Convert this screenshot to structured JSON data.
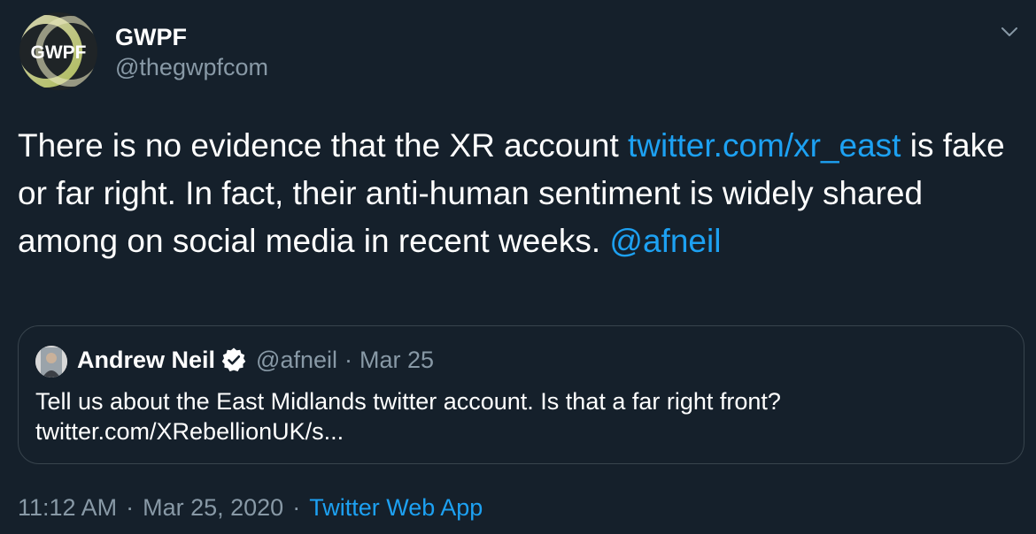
{
  "author": {
    "display_name": "GWPF",
    "handle": "@thegwpfcom",
    "avatar_text": "GWPF"
  },
  "tweet": {
    "text_part1": "There is no evidence that the XR account ",
    "link1": "twitter.com/xr_east",
    "text_part2": " is fake or far right. In fact, their anti-human sentiment is widely shared among on social media in recent weeks. ",
    "mention": "@afneil"
  },
  "quoted_tweet": {
    "display_name": "Andrew Neil",
    "verified": true,
    "handle": "@afneil",
    "separator": "·",
    "date": "Mar 25",
    "text_line1": "Tell us about the East Midlands twitter account. Is that a far right front?",
    "text_line2": "twitter.com/XRebellionUK/s..."
  },
  "meta": {
    "time": "11:12 AM",
    "separator": "·",
    "date": "Mar 25, 2020",
    "separator2": "·",
    "source": "Twitter Web App"
  },
  "colors": {
    "background": "#15202b",
    "link": "#1da1f2",
    "secondary_text": "#8899a6",
    "border": "#38444d"
  }
}
